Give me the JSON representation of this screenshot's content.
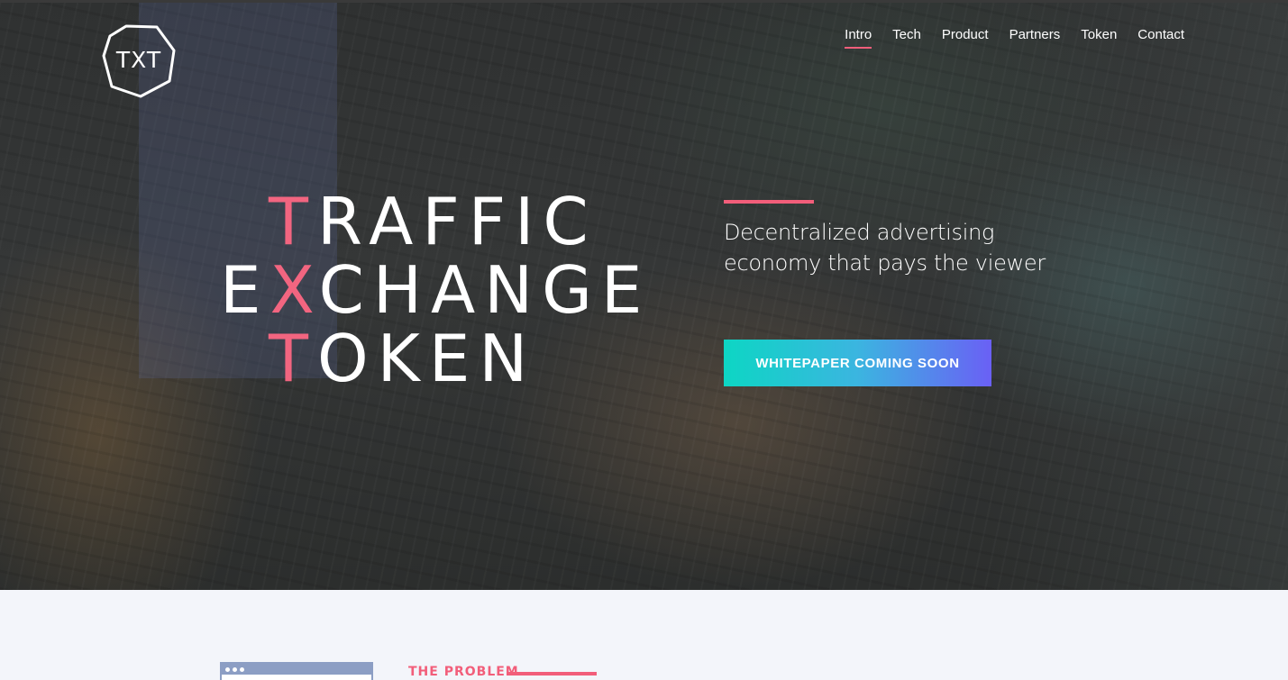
{
  "brand": {
    "logo_text": "TXT",
    "logo_icon": "hexagon-logo-icon"
  },
  "nav": {
    "items": [
      {
        "label": "Intro",
        "active": true
      },
      {
        "label": "Tech",
        "active": false
      },
      {
        "label": "Product",
        "active": false
      },
      {
        "label": "Partners",
        "active": false
      },
      {
        "label": "Token",
        "active": false
      },
      {
        "label": "Contact",
        "active": false
      }
    ]
  },
  "hero": {
    "title": {
      "line1": {
        "highlight": "T",
        "rest": "RAFFIC"
      },
      "line2": {
        "before": "E",
        "highlight": "X",
        "rest": "CHANGE"
      },
      "line3": {
        "highlight": "T",
        "rest": "OKEN"
      }
    },
    "tagline": "Decentralized advertising economy that pays the viewer",
    "cta_label": "WHITEPAPER COMING SOON"
  },
  "problem": {
    "label": "THE PROBLEM",
    "icon": "browser-window-icon"
  },
  "colors": {
    "accent": "#f25e7a",
    "cta_gradient_start": "#0dd6c4",
    "cta_gradient_end": "#6a60f5",
    "section_bg": "#f3f5fa"
  }
}
